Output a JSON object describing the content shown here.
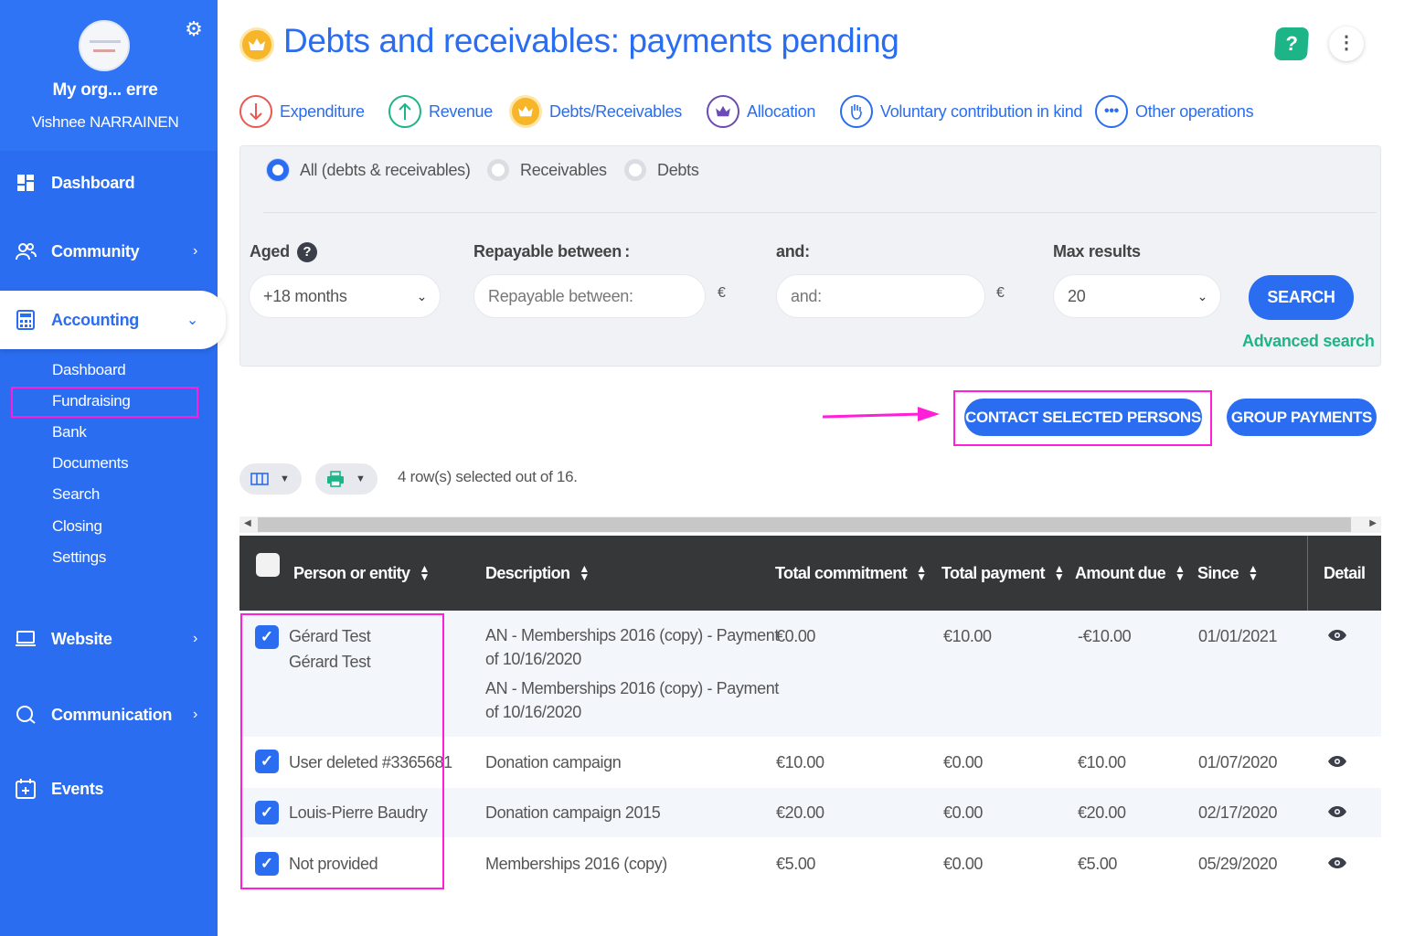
{
  "sidebar": {
    "org_name": "My org... erre",
    "user_name": "Vishnee NARRAINEN",
    "nav": {
      "dashboard": "Dashboard",
      "community": "Community",
      "accounting": "Accounting",
      "website": "Website",
      "communication": "Communication",
      "events": "Events"
    },
    "accounting_sub": [
      "Dashboard",
      "Fundraising",
      "Bank",
      "Documents",
      "Search",
      "Closing",
      "Settings"
    ]
  },
  "header": {
    "title": "Debts and receivables: payments pending",
    "help": "?"
  },
  "operation_tabs": [
    "Expenditure",
    "Revenue",
    "Debts/Receivables",
    "Allocation",
    "Voluntary contribution in kind",
    "Other operations"
  ],
  "filters": {
    "type_options": [
      "All (debts & receivables)",
      "Receivables",
      "Debts"
    ],
    "type_selected": "All (debts & receivables)",
    "aged_label": "Aged",
    "aged_value": "+18 months",
    "repayable_label": "Repayable between :",
    "repayable_placeholder": "Repayable between:",
    "and_label": "and:",
    "and_placeholder": "and:",
    "currency": "€",
    "max_results_label": "Max results",
    "max_results_value": "20",
    "search_button": "SEARCH",
    "advanced_search": "Advanced search"
  },
  "actions": {
    "contact_selected": "CONTACT SELECTED PERSONS",
    "group_payments": "GROUP PAYMENTS"
  },
  "table": {
    "selection_info": "4 row(s) selected out of 16.",
    "columns": [
      "Person or entity",
      "Description",
      "Total commitment",
      "Total payment",
      "Amount due",
      "Since",
      "Detail"
    ],
    "rows": [
      {
        "person": [
          "Gérard Test",
          "Gérard Test"
        ],
        "description": [
          "AN - Memberships 2016 (copy) - Payment",
          "of 10/16/2020",
          "AN - Memberships 2016 (copy) - Payment",
          "of 10/16/2020"
        ],
        "total_commitment": "€0.00",
        "total_payment": "€10.00",
        "amount_due": "-€10.00",
        "since": "01/01/2021",
        "checked": true
      },
      {
        "person": [
          "User deleted #3365681"
        ],
        "description": [
          "Donation campaign"
        ],
        "total_commitment": "€10.00",
        "total_payment": "€0.00",
        "amount_due": "€10.00",
        "since": "01/07/2020",
        "checked": true
      },
      {
        "person": [
          "Louis-Pierre Baudry"
        ],
        "description": [
          "Donation campaign 2015"
        ],
        "total_commitment": "€20.00",
        "total_payment": "€0.00",
        "amount_due": "€20.00",
        "since": "02/17/2020",
        "checked": true
      },
      {
        "person": [
          "Not provided"
        ],
        "description": [
          "Memberships 2016 (copy)"
        ],
        "total_commitment": "€5.00",
        "total_payment": "€0.00",
        "amount_due": "€5.00",
        "since": "05/29/2020",
        "checked": true
      }
    ]
  },
  "colors": {
    "primary": "#2a6df0",
    "green": "#1db488",
    "highlight": "#ff1fd8",
    "header_dark": "#363738"
  }
}
